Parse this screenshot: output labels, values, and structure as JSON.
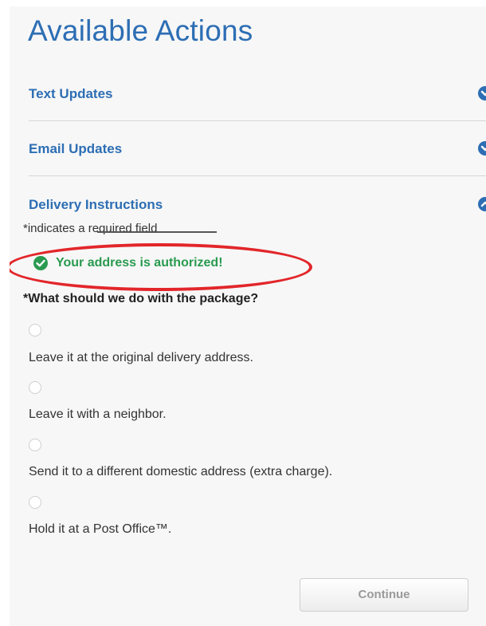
{
  "header": {
    "title": "Available Actions"
  },
  "accordion": {
    "items": [
      {
        "label": "Text Updates",
        "state": "collapsed",
        "icon": "chevron-down-icon"
      },
      {
        "label": "Email Updates",
        "state": "collapsed",
        "icon": "chevron-down-icon"
      },
      {
        "label": "Delivery Instructions",
        "state": "expanded",
        "icon": "chevron-up-icon"
      }
    ]
  },
  "form": {
    "required_note": "*indicates a required field",
    "auth_message": "Your address is authorized!",
    "auth_icon": "check-circle-icon",
    "question": "*What should we do with the package?",
    "options": [
      {
        "label": "Leave it at the original delivery address.",
        "selected": false
      },
      {
        "label": "Leave it with a neighbor.",
        "selected": false
      },
      {
        "label": "Send it to a different domestic address (extra charge).",
        "selected": false
      },
      {
        "label": "Hold it at a Post Office™.",
        "selected": false
      }
    ],
    "continue_label": "Continue"
  },
  "colors": {
    "accent": "#2d6eb4",
    "success": "#2a9a50",
    "annotation": "#e2262a"
  }
}
